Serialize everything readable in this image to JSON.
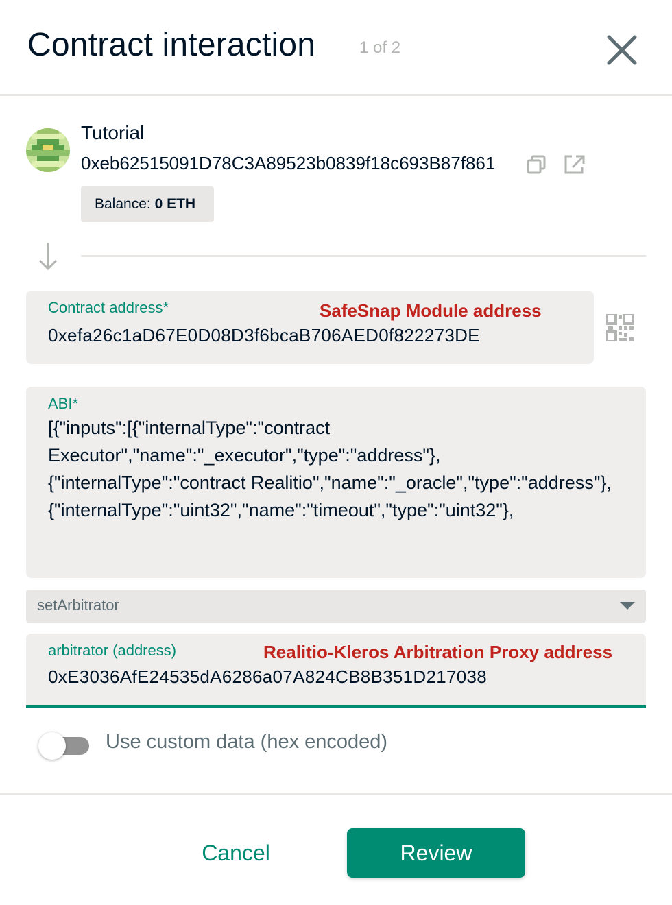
{
  "header": {
    "title": "Contract interaction",
    "step": "1 of 2",
    "close_icon": "close-icon"
  },
  "sender": {
    "name": "Tutorial",
    "address": "0xeb62515091D78C3A89523b0839f18c693B87f861",
    "balance_label": "Balance: ",
    "balance_value": "0 ETH",
    "copy_icon": "copy-icon",
    "open_icon": "external-link-icon"
  },
  "contract": {
    "label": "Contract address*",
    "value": "0xefa26c1aD67E0D08D3f6bcaB706AED0f822273DE",
    "annotation": "SafeSnap Module address",
    "qr_icon": "qr-code-icon"
  },
  "abi": {
    "label": "ABI*",
    "value": "[{\"inputs\":[{\"internalType\":\"contract Executor\",\"name\":\"_executor\",\"type\":\"address\"},\n{\"internalType\":\"contract Realitio\",\"name\":\"_oracle\",\"type\":\"address\"},\n{\"internalType\":\"uint32\",\"name\":\"timeout\",\"type\":\"uint32\"},"
  },
  "method": {
    "selected": "setArbitrator"
  },
  "argument": {
    "label": "arbitrator (address)",
    "value": "0xE3036AfE24535dA6286a07A824CB8B351D217038",
    "annotation": "Realitio-Kleros Arbitration Proxy address"
  },
  "custom_data": {
    "label": "Use custom data (hex encoded)",
    "enabled": false
  },
  "footer": {
    "cancel_label": "Cancel",
    "review_label": "Review"
  },
  "colors": {
    "accent": "#008c73",
    "annotation": "#c0241c",
    "text": "#001428",
    "field_bg": "#efeeed"
  }
}
